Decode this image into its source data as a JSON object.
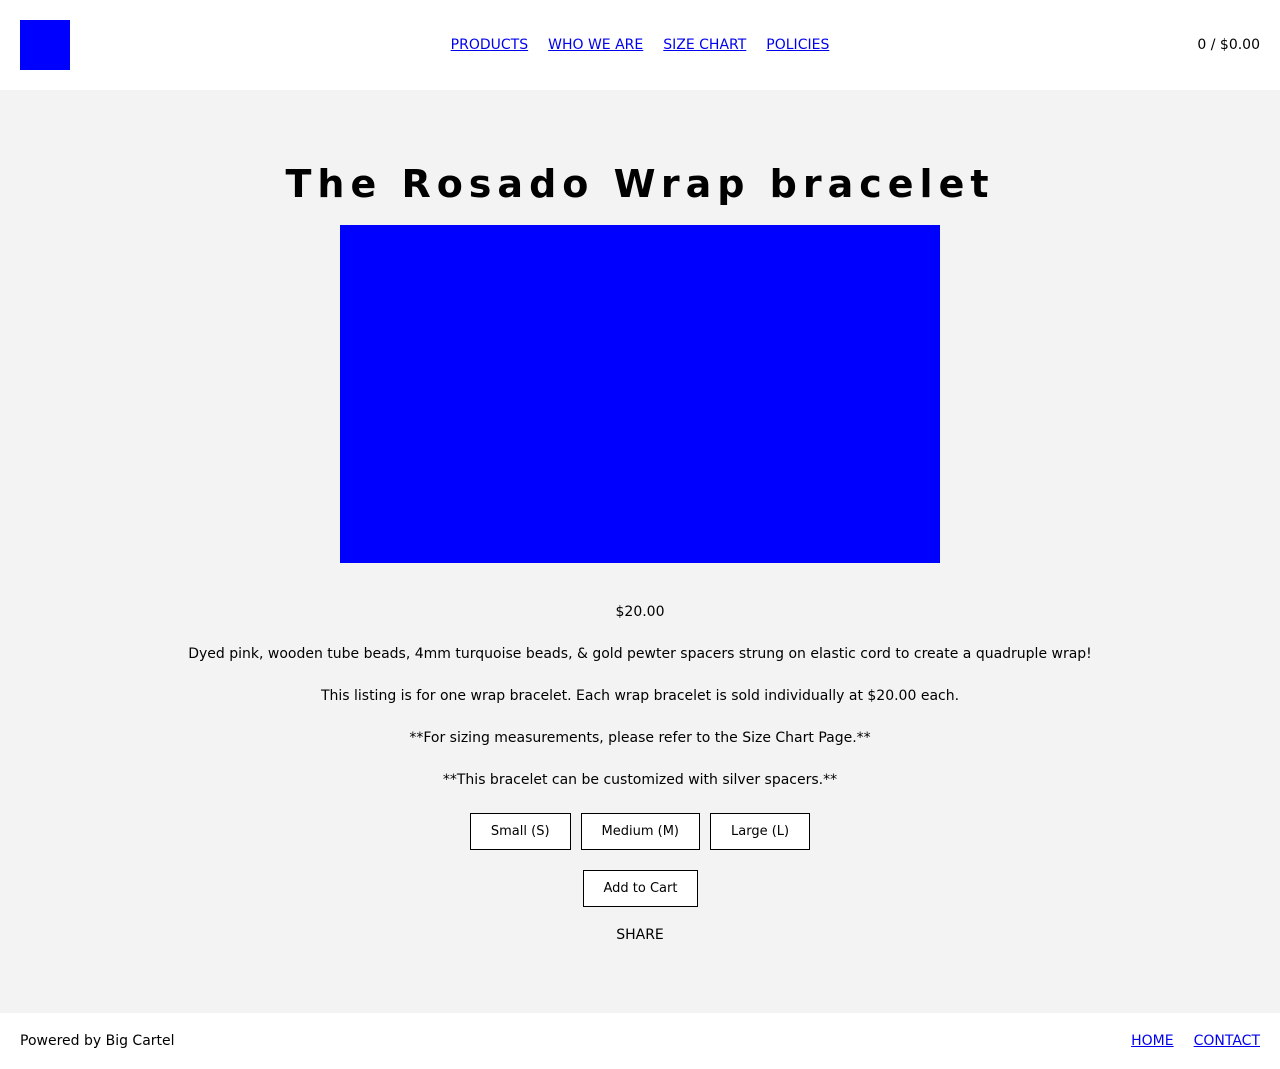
{
  "header": {
    "nav": [
      {
        "label": "PRODUCTS"
      },
      {
        "label": "WHO WE ARE"
      },
      {
        "label": "SIZE CHART"
      },
      {
        "label": "POLICIES"
      }
    ],
    "cart": "0 / $0.00"
  },
  "product": {
    "title": "The Rosado Wrap bracelet",
    "price": "$20.00",
    "description": [
      "Dyed pink, wooden tube beads, 4mm turquoise beads, & gold pewter spacers strung on elastic cord to create a quadruple wrap!",
      "This listing is for one wrap bracelet. Each wrap bracelet is sold individually at $20.00 each.",
      "**For sizing measurements, please refer to the Size Chart Page.**",
      "**This bracelet can be customized with silver spacers.**"
    ],
    "sizes": [
      {
        "label": "Small (S)"
      },
      {
        "label": "Medium (M)"
      },
      {
        "label": "Large (L)"
      }
    ],
    "add_to_cart": "Add to Cart",
    "share": "SHARE"
  },
  "footer": {
    "powered_by": "Powered by Big Cartel",
    "links": [
      {
        "label": "HOME"
      },
      {
        "label": "CONTACT"
      }
    ]
  },
  "colors": {
    "placeholder_blue": "#0000ff",
    "link": "#0000ee",
    "background": "#f3f3f3"
  }
}
